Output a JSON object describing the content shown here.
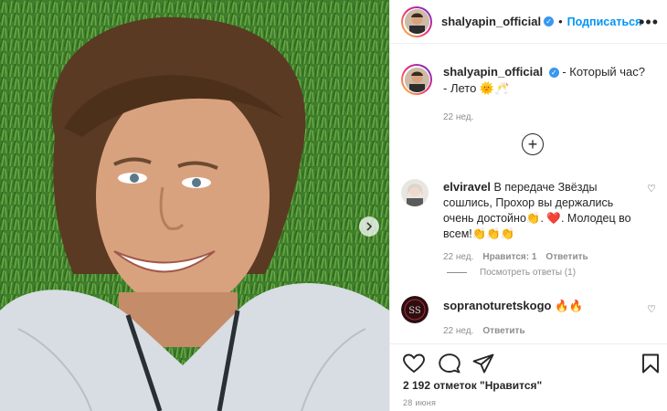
{
  "header": {
    "username": "shalyapin_official",
    "verified_glyph": "✓",
    "separator": "•",
    "follow_label": "Подписаться",
    "more_glyph": "•••"
  },
  "caption": {
    "username": "shalyapin_official",
    "verified_glyph": "✓",
    "line1": "- Который час?",
    "line2": "- Лето 🌞🥂",
    "time": "22 нед."
  },
  "load_more_glyph": "+",
  "comments": [
    {
      "username": "elviravel",
      "text": "В передаче Звёзды сошлись, Прохор вы держались очень достойно👏. ❤️. Молодец во всем!👏👏👏",
      "time": "22 нед.",
      "likes": "Нравится: 1",
      "reply": "Ответить",
      "view_replies": "Посмотреть ответы (1)"
    },
    {
      "username": "sopranoturetskogo",
      "text": "🔥🔥",
      "time": "22 нед.",
      "reply": "Ответить"
    }
  ],
  "likes_text": "2 192 отметок \"Нравится\"",
  "date_text": "28 июня",
  "colors": {
    "accent": "#0095f6",
    "verified": "#3897f0",
    "muted": "#8e8e8e",
    "text": "#262626"
  },
  "icons": [
    "heart-icon",
    "comment-icon",
    "share-icon",
    "bookmark-icon",
    "plus-circle-icon",
    "more-icon",
    "chevron-right-icon",
    "verified-icon"
  ]
}
